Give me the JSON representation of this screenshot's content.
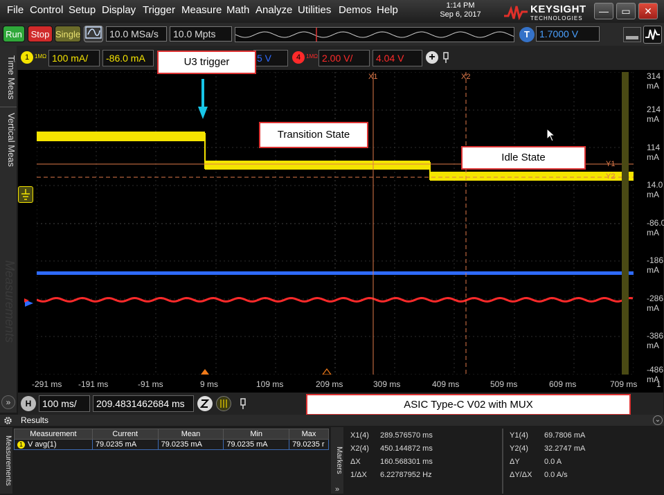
{
  "menu": [
    "File",
    "Control",
    "Setup",
    "Display",
    "Trigger",
    "Measure",
    "Math",
    "Analyze",
    "Utilities",
    "Demos",
    "Help"
  ],
  "clock": {
    "time": "1:14 PM",
    "date": "Sep 6, 2017"
  },
  "brand": {
    "name": "KEYSIGHT",
    "sub": "TECHNOLOGIES"
  },
  "window_controls": {
    "minimize": "—",
    "maximize": "▭",
    "close": "✕"
  },
  "colors": {
    "ch1": "#f5e400",
    "ch2": "#2e6bff",
    "ch4": "#ff2a2a",
    "accent_red": "#d33"
  },
  "control": {
    "run": "Run",
    "stop": "Stop",
    "single": "Single",
    "sample_rate": "10.0 MSa/s",
    "memory_depth": "10.0 Mpts",
    "trigger_badge": "T",
    "trigger_level": "1.7000 V"
  },
  "channels": {
    "ch1": {
      "number": "1",
      "impedance": "1MΩ",
      "scale": "100 mA/",
      "offset": "-86.0 mA"
    },
    "ch3_partial": "5 V",
    "ch4": {
      "number": "4",
      "impedance": "1MΩ",
      "scale": "2.00 V/",
      "offset": "4.04 V"
    },
    "add_label": "+"
  },
  "left_tabs": {
    "time_meas": "Time Meas",
    "vertical_meas": "Vertical Meas",
    "measurements": "Measurements"
  },
  "callouts": {
    "trigger": "U3 trigger",
    "transition": "Transition State",
    "idle": "Idle State"
  },
  "markers": {
    "x1": "X1",
    "x2": "X2",
    "y1": "Y1",
    "y2": "Y2"
  },
  "y_labels": [
    "314 mA",
    "214 mA",
    "114 mA",
    "14.0 mA",
    "-86.0 mA",
    "-186 mA",
    "-286 mA",
    "-386 mA",
    "-486 mA"
  ],
  "x_labels": [
    "-291 ms",
    "-191 ms",
    "-91 ms",
    "9 ms",
    "109 ms",
    "209 ms",
    "309 ms",
    "409 ms",
    "509 ms",
    "609 ms",
    "709 ms"
  ],
  "x_page": "1",
  "horizontal": {
    "badge": "H",
    "scale": "100 ms/",
    "position": "209.4831462684 ms"
  },
  "title_box": "ASIC Type-C V02 with MUX",
  "results": {
    "header": "Results",
    "columns": [
      "Measurement",
      "Current",
      "Mean",
      "Min",
      "Max"
    ],
    "row": {
      "name": "V avg(1)",
      "current": "79.0235 mA",
      "mean": "79.0235 mA",
      "min": "79.0235 mA",
      "max": "79.0235 r"
    }
  },
  "markers_tab": "Markers",
  "marker_readout": {
    "left": [
      {
        "k": "X1(4)",
        "v": "289.576570 ms"
      },
      {
        "k": "X2(4)",
        "v": "450.144872 ms"
      },
      {
        "k": "ΔX",
        "v": "160.568301 ms"
      },
      {
        "k": "1/ΔX",
        "v": "6.22787952 Hz"
      }
    ],
    "right": [
      {
        "k": "Y1(4)",
        "v": "69.7806 mA"
      },
      {
        "k": "Y2(4)",
        "v": "32.2747 mA"
      },
      {
        "k": "ΔY",
        "v": "0.0 A"
      },
      {
        "k": "ΔY/ΔX",
        "v": "0.0 A/s"
      }
    ]
  }
}
